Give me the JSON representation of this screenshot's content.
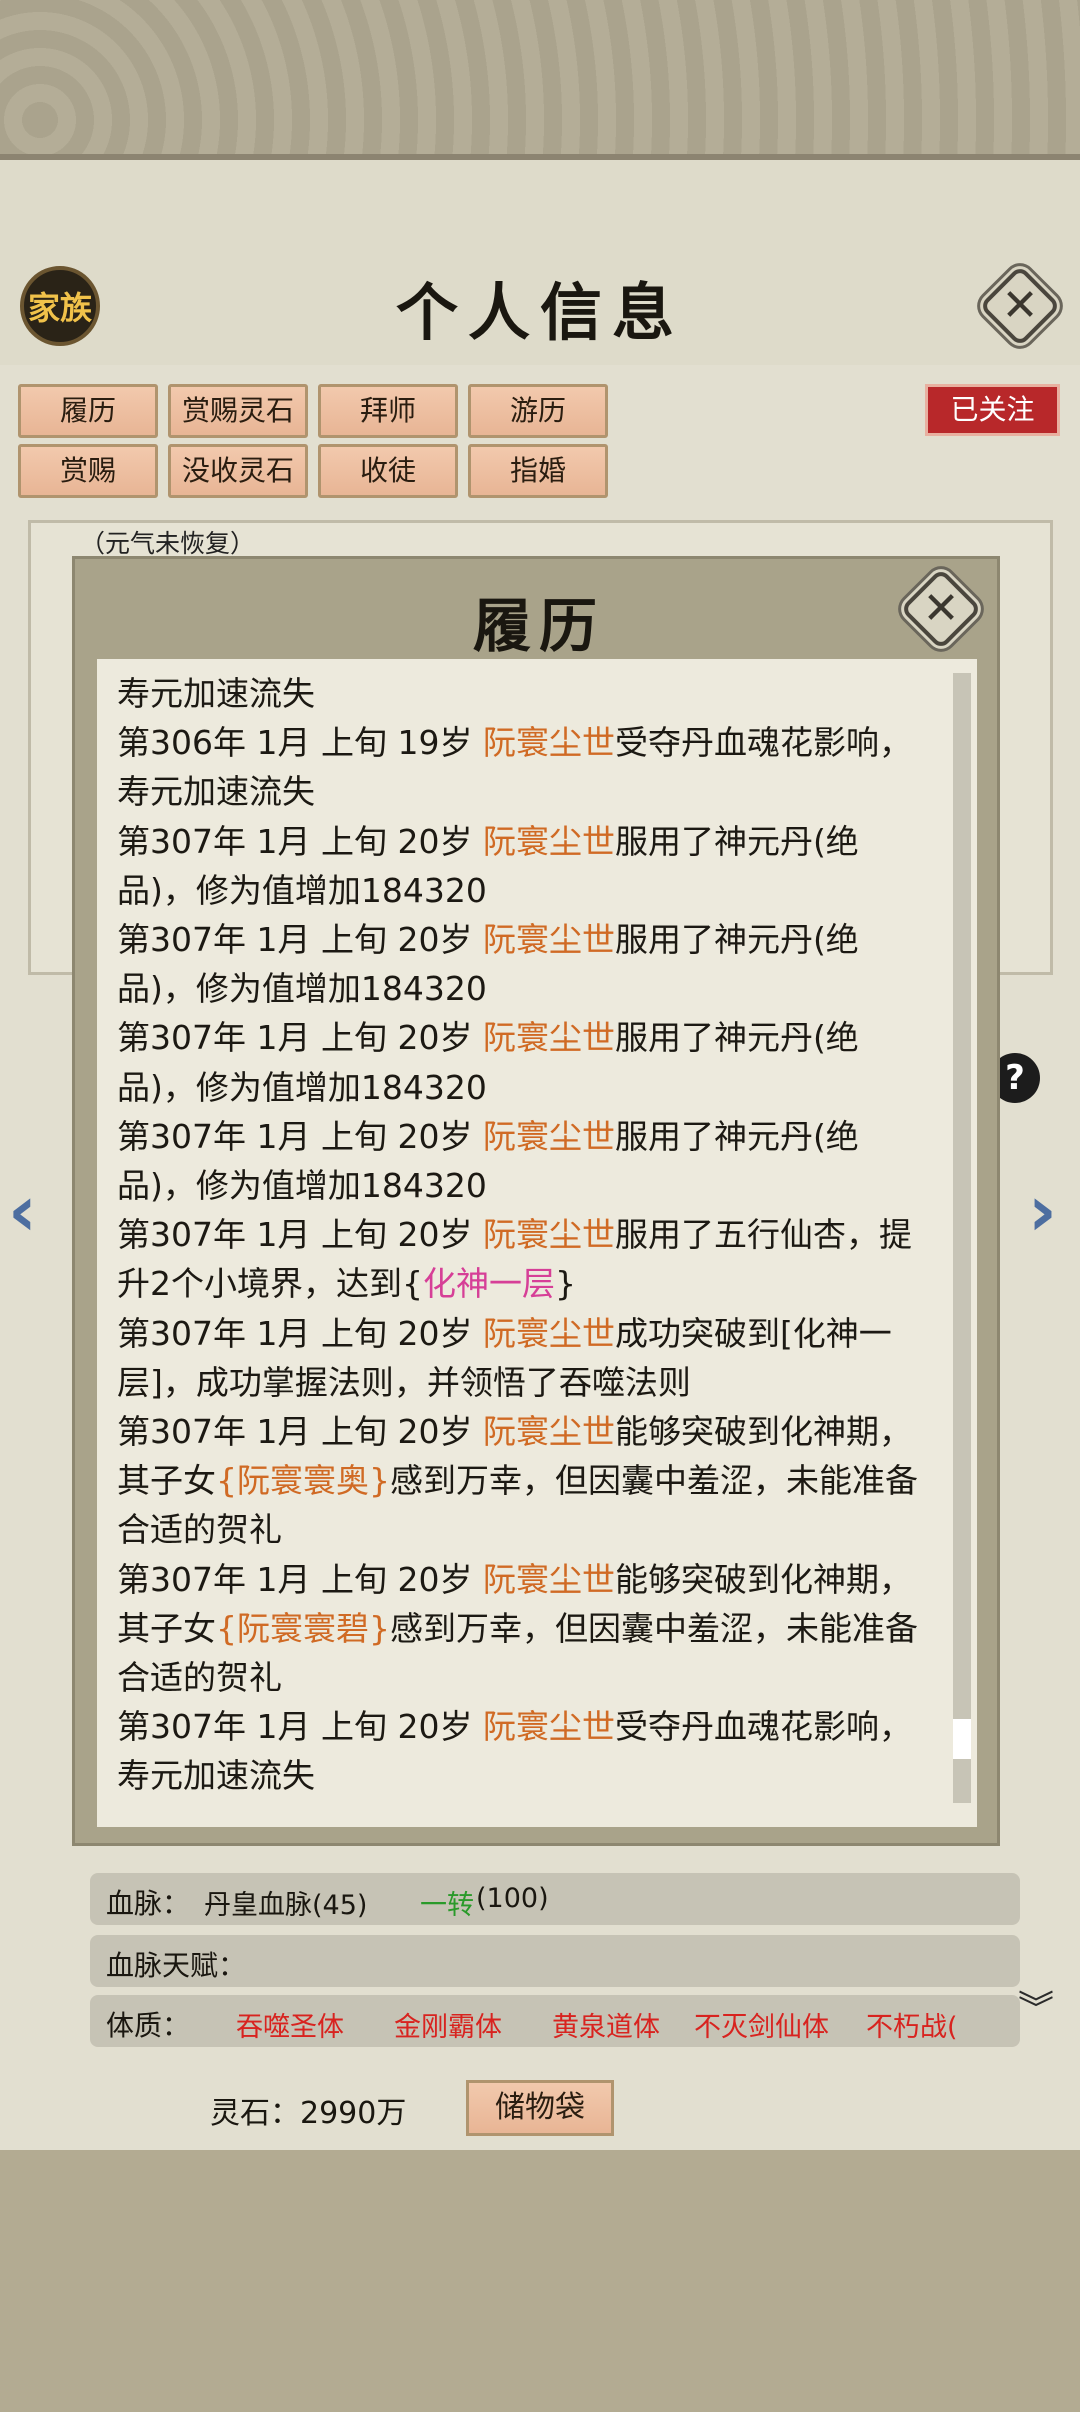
{
  "header": {
    "title": "个人信息",
    "family_label": "家族",
    "followed_label": "已关注"
  },
  "actions": [
    {
      "label": "履历"
    },
    {
      "label": "赏赐灵石"
    },
    {
      "label": "拜师"
    },
    {
      "label": "游历"
    },
    {
      "label": "赏赐"
    },
    {
      "label": "没收灵石"
    },
    {
      "label": "收徒"
    },
    {
      "label": "指婚"
    }
  ],
  "info": {
    "vigor_note": "（元气未恢复）"
  },
  "modal": {
    "title": "履历",
    "lines": [
      [
        {
          "t": "寿元加速流失"
        }
      ],
      [
        {
          "t": "第306年 1月 上旬 19岁 "
        },
        {
          "t": "阮寰尘世",
          "c": "name"
        },
        {
          "t": "受夺丹血魂花影响，"
        }
      ],
      [
        {
          "t": "寿元加速流失"
        }
      ],
      [
        {
          "t": "第307年 1月 上旬  20岁  "
        },
        {
          "t": "阮寰尘世",
          "c": "name"
        },
        {
          "t": "服用了神元丹(绝"
        }
      ],
      [
        {
          "t": "品)，修为值增加184320"
        }
      ],
      [
        {
          "t": "第307年 1月 上旬  20岁  "
        },
        {
          "t": "阮寰尘世",
          "c": "name"
        },
        {
          "t": "服用了神元丹(绝"
        }
      ],
      [
        {
          "t": "品)，修为值增加184320"
        }
      ],
      [
        {
          "t": "第307年 1月 上旬  20岁  "
        },
        {
          "t": "阮寰尘世",
          "c": "name"
        },
        {
          "t": "服用了神元丹(绝"
        }
      ],
      [
        {
          "t": "品)，修为值增加184320"
        }
      ],
      [
        {
          "t": "第307年 1月 上旬  20岁  "
        },
        {
          "t": "阮寰尘世",
          "c": "name"
        },
        {
          "t": "服用了神元丹(绝"
        }
      ],
      [
        {
          "t": "品)，修为值增加184320"
        }
      ],
      [
        {
          "t": "第307年 1月 上旬 20岁 "
        },
        {
          "t": "阮寰尘世",
          "c": "name"
        },
        {
          "t": "服用了五行仙杏，提"
        }
      ],
      [
        {
          "t": "升2个小境界，达到{"
        },
        {
          "t": "化神一层",
          "c": "realm"
        },
        {
          "t": "}"
        }
      ],
      [
        {
          "t": "第307年 1月 上旬 20岁 "
        },
        {
          "t": "阮寰尘世",
          "c": "name"
        },
        {
          "t": "成功突破到[化神一"
        }
      ],
      [
        {
          "t": "层]，成功掌握法则，并领悟了吞噬法则"
        }
      ],
      [
        {
          "t": "第307年 1月 上旬 20岁 "
        },
        {
          "t": "阮寰尘世",
          "c": "name"
        },
        {
          "t": "能够突破到化神期，"
        }
      ],
      [
        {
          "t": "其子女"
        },
        {
          "t": "{阮寰寰奥}",
          "c": "name"
        },
        {
          "t": "感到万幸，但因囊中羞涩，未能准备"
        }
      ],
      [
        {
          "t": "合适的贺礼"
        }
      ],
      [
        {
          "t": "第307年 1月 上旬 20岁 "
        },
        {
          "t": "阮寰尘世",
          "c": "name"
        },
        {
          "t": "能够突破到化神期，"
        }
      ],
      [
        {
          "t": "其子女"
        },
        {
          "t": "{阮寰寰碧}",
          "c": "name"
        },
        {
          "t": "感到万幸，但因囊中羞涩，未能准备"
        }
      ],
      [
        {
          "t": "合适的贺礼"
        }
      ],
      [
        {
          "t": "第307年 1月 上旬 20岁 "
        },
        {
          "t": "阮寰尘世",
          "c": "name"
        },
        {
          "t": "受夺丹血魂花影响，"
        }
      ],
      [
        {
          "t": "寿元加速流失"
        }
      ]
    ]
  },
  "bloodline": {
    "label": "血脉：",
    "value": "丹皇血脉(45)",
    "turn_label": "一转",
    "turn_value": "(100)"
  },
  "bloodline_talent": {
    "label": "血脉天赋："
  },
  "physique": {
    "label": "体质：",
    "items": [
      "吞噬圣体",
      "金刚霸体",
      "黄泉道体",
      "不灭剑仙体",
      "不朽战("
    ]
  },
  "footer": {
    "money_label": "灵石：2990万",
    "storage_label": "储物袋"
  },
  "colors": {
    "name": "#d06a24",
    "realm": "#d63f97",
    "physique": "#d8231f",
    "turn": "#2a9a2a"
  },
  "icons": [
    "close-icon",
    "help-icon",
    "chevron-left-icon",
    "chevron-right-icon",
    "chevron-down-icon"
  ]
}
